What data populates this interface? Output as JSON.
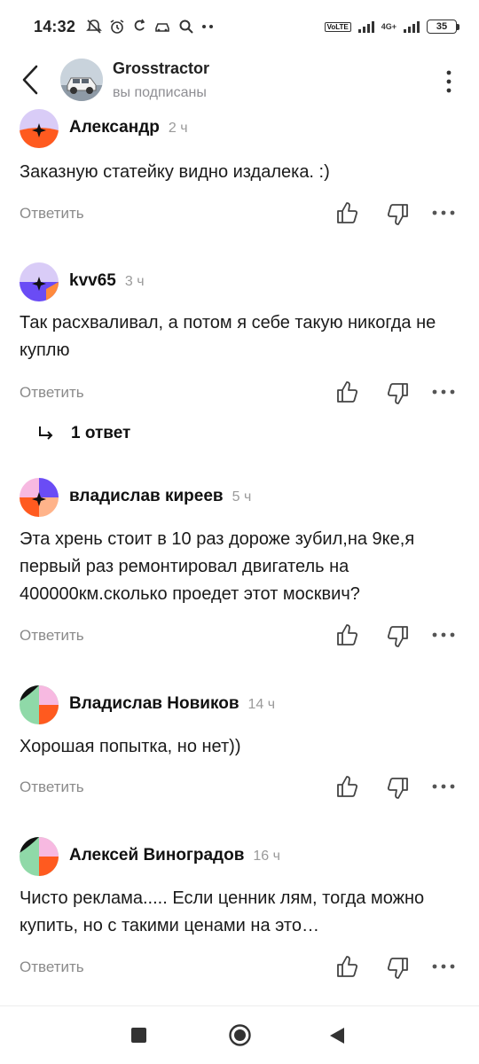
{
  "status_bar": {
    "time": "14:32",
    "network_tag_1": "VoLTE",
    "network_tag_2": "4G+",
    "battery": "35"
  },
  "header": {
    "channel_name": "Grosstractor",
    "subscription_status": "вы подписаны"
  },
  "comments": [
    {
      "author": "Александр",
      "time": "2 ч",
      "text": "Заказную статейку видно издалека. :)",
      "reply_label": "Ответить"
    },
    {
      "author": "kvv65",
      "time": "3 ч",
      "text": "Так расхваливал, а потом я себе такую никогда не куплю",
      "reply_label": "Ответить"
    },
    {
      "author": "владислав киреев",
      "time": "5 ч",
      "text": "Эта хрень стоит в 10 раз дороже зубил,на 9ке,я первый раз ремонтировал двигатель на 400000км.сколько проедет этот москвич?",
      "reply_label": "Ответить"
    },
    {
      "author": "Владислав Новиков",
      "time": "14 ч",
      "text": "Хорошая попытка, но нет))",
      "reply_label": "Ответить"
    },
    {
      "author": "Алексей Виноградов",
      "time": "16 ч",
      "text": "Чисто реклама..... Если ценник лям, тогда можно купить, но с такими ценами на это…",
      "reply_label": "Ответить"
    }
  ],
  "thread": {
    "replies_label": "1 ответ"
  },
  "colors": {
    "accent_orange": "#FF5A1F",
    "accent_purple": "#6A4CF5",
    "lavender": "#D9CCF7",
    "pink": "#F7B9E1",
    "mint": "#8FD9A8",
    "text_secondary": "#8a8a8a"
  },
  "icons": {
    "back": "chevron-left-icon",
    "more": "more-vertical-icon",
    "like": "thumbs-up-icon",
    "dislike": "thumbs-down-icon",
    "reply_thread": "arrow-return-icon",
    "nav_recent": "square-icon",
    "nav_home": "circle-icon",
    "nav_back": "triangle-back-icon"
  }
}
